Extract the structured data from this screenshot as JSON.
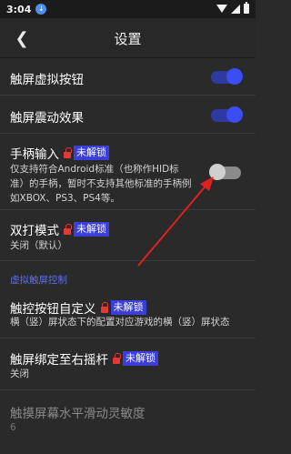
{
  "status_bar": {
    "time": "3:04",
    "download_icon": "download-arrow-icon"
  },
  "header": {
    "back_glyph": "❮",
    "title": "设置"
  },
  "settings": [
    {
      "title": "触屏虚拟按钮",
      "toggle": true
    },
    {
      "title": "触屏震动效果",
      "toggle": true
    },
    {
      "title": "手柄输入",
      "locked": true,
      "badge": "未解锁",
      "desc_lines": [
        "仅支持符合Android标准（也称作HID标",
        "准）的手柄，暂时不支持其他标准的手柄例",
        "如XBOX、PS3、PS4等。"
      ],
      "toggle": false
    },
    {
      "title": "双打模式",
      "locked": true,
      "badge": "未解锁",
      "desc": "关闭（默认）"
    }
  ],
  "section": {
    "label": "虚拟触屏控制"
  },
  "touch_settings": [
    {
      "title": "触控按钮自定义",
      "locked": true,
      "badge": "未解锁",
      "desc": "横（竖）屏状态下的配置对应游戏的横（竖）屏状态"
    },
    {
      "title": "触屏绑定至右摇杆",
      "locked": true,
      "badge": "未解锁",
      "desc": "关闭"
    },
    {
      "title": "触摸屏幕水平滑动灵敏度",
      "desc": "6",
      "disabled": true
    }
  ],
  "colors": {
    "accent": "#3a4ef3",
    "badge": "#3b3fd6",
    "lock": "#e53935",
    "arrow": "#e02020",
    "section_header": "#5d6ef0"
  }
}
